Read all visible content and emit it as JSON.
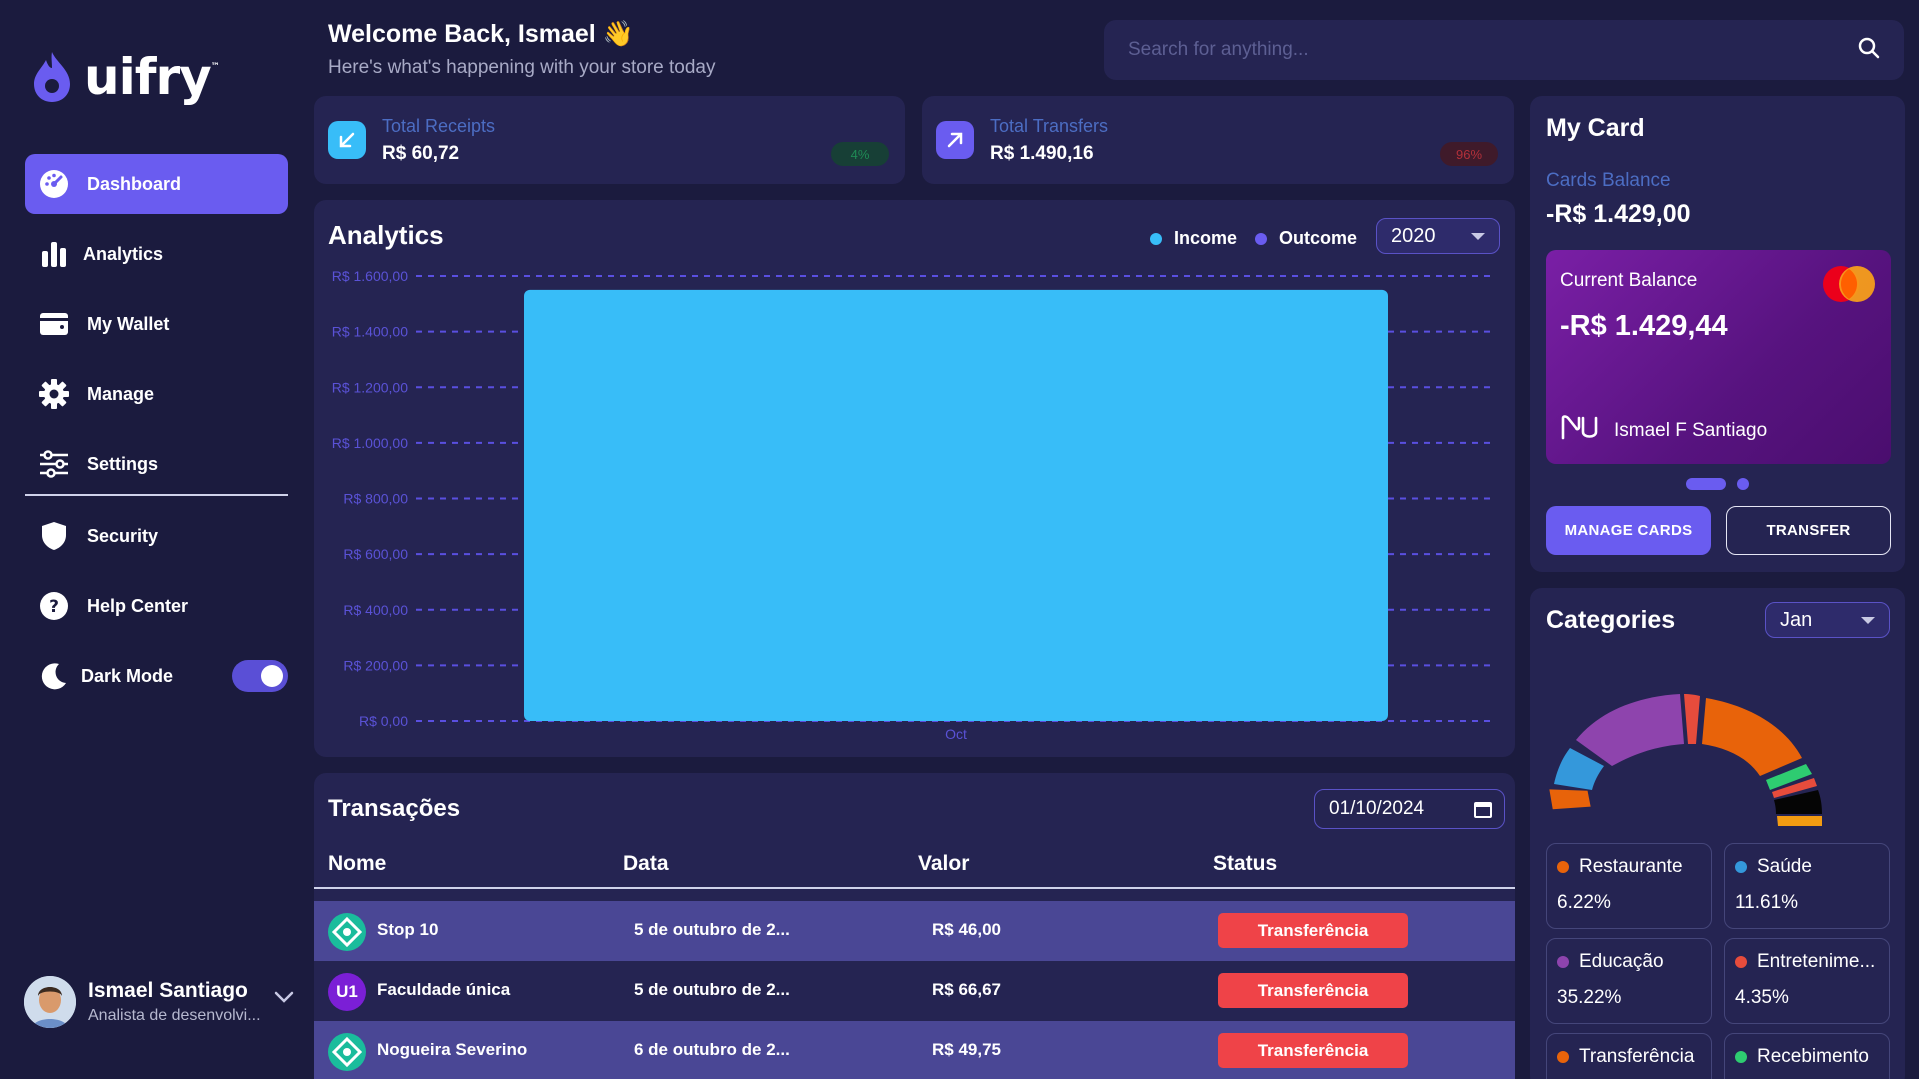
{
  "brand": {
    "name": "uifry",
    "tm": "™"
  },
  "sidebar": {
    "items": [
      {
        "label": "Dashboard",
        "icon": "dashboard-icon"
      },
      {
        "label": "Analytics",
        "icon": "bar-chart-icon"
      },
      {
        "label": "My Wallet",
        "icon": "wallet-icon"
      },
      {
        "label": "Manage",
        "icon": "gear-icon"
      },
      {
        "label": "Settings",
        "icon": "sliders-icon"
      },
      {
        "label": "Security",
        "icon": "shield-icon"
      },
      {
        "label": "Help Center",
        "icon": "help-icon"
      }
    ],
    "dark_mode_label": "Dark Mode",
    "dark_mode_on": true
  },
  "user": {
    "name": "Ismael Santiago",
    "role": "Analista de desenvolvi..."
  },
  "header": {
    "title": "Welcome Back, Ismael 👋",
    "subtitle": "Here's what's happening with your store today",
    "search_placeholder": "Search for anything..."
  },
  "stats": [
    {
      "label": "Total Receipts",
      "value": "R$ 60,72",
      "badge": "4%",
      "badge_color": "#2ecc71"
    },
    {
      "label": "Total Transfers",
      "value": "R$ 1.490,16",
      "badge": "96%",
      "badge_color": "#e74c3c"
    }
  ],
  "analytics": {
    "title": "Analytics",
    "legend": [
      {
        "label": "Income",
        "color": "#38bdf8"
      },
      {
        "label": "Outcome",
        "color": "#6a5cf0"
      }
    ],
    "year": "2020"
  },
  "chart_data": {
    "type": "bar",
    "categories": [
      "Oct"
    ],
    "series": [
      {
        "name": "Income",
        "values": [
          1550
        ]
      }
    ],
    "ylim": [
      0,
      1600
    ],
    "yticks": [
      0,
      200,
      400,
      600,
      800,
      1000,
      1200,
      1400,
      1600
    ],
    "ytick_labels": [
      "R$ 0,00",
      "R$ 200,00",
      "R$ 400,00",
      "R$ 600,00",
      "R$ 800,00",
      "R$ 1.000,00",
      "R$ 1.200,00",
      "R$ 1.400,00",
      "R$ 1.600,00"
    ],
    "grid": true,
    "bar_color": "#38bdf8"
  },
  "transactions": {
    "title": "Transações",
    "date_filter": "01/10/2024",
    "columns": [
      "Nome",
      "Data",
      "Valor",
      "Status"
    ],
    "rows": [
      {
        "name": "Stop 10",
        "date": "5 de outubro de 2...",
        "value": "R$ 46,00",
        "status": "Transferência",
        "logo": "teal"
      },
      {
        "name": "Faculdade única",
        "date": "5 de outubro de 2...",
        "value": "R$ 66,67",
        "status": "Transferência",
        "logo": "purple",
        "logo_text": "U1"
      },
      {
        "name": "Nogueira Severino",
        "date": "6 de outubro de 2...",
        "value": "R$ 49,75",
        "status": "Transferência",
        "logo": "teal"
      }
    ]
  },
  "my_card": {
    "title": "My Card",
    "balance_label": "Cards Balance",
    "balance": "-R$ 1.429,00",
    "card": {
      "label": "Current Balance",
      "value": "-R$ 1.429,44",
      "holder": "Ismael F Santiago"
    },
    "manage_label": "MANAGE CARDS",
    "transfer_label": "TRANSFER"
  },
  "categories": {
    "title": "Categories",
    "month": "Jan",
    "items": [
      {
        "name": "Restaurante",
        "value": "6.22%",
        "color": "#e8630a"
      },
      {
        "name": "Saúde",
        "value": "11.61%",
        "color": "#3498db"
      },
      {
        "name": "Educação",
        "value": "35.22%",
        "color": "#8e44ad"
      },
      {
        "name": "Entretenime...",
        "value": "4.35%",
        "color": "#e74c3c"
      },
      {
        "name": "Transferência",
        "value": "",
        "color": "#e8630a"
      },
      {
        "name": "Recebimento",
        "value": "",
        "color": "#2ecc71"
      }
    ]
  }
}
